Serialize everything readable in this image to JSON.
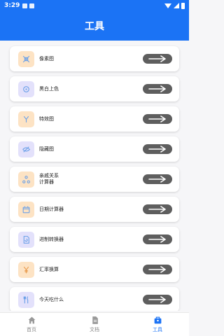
{
  "status": {
    "time": "3:29"
  },
  "appbar": {
    "title": "工具"
  },
  "tools": [
    {
      "label": "像素图",
      "icon": "pixel-grid-icon",
      "tint": "orange"
    },
    {
      "label": "黑白上色",
      "icon": "colorize-icon",
      "tint": "purple"
    },
    {
      "label": "特效图",
      "icon": "effect-icon",
      "tint": "orange"
    },
    {
      "label": "隐藏图",
      "icon": "hidden-image-icon",
      "tint": "purple"
    },
    {
      "label": "亲戚关系\n计算器",
      "icon": "family-tree-icon",
      "tint": "orange"
    },
    {
      "label": "日期计算器",
      "icon": "calendar-icon",
      "tint": "orange"
    },
    {
      "label": "进制转换器",
      "icon": "base-convert-icon",
      "tint": "purple"
    },
    {
      "label": "汇率换算",
      "icon": "yen-icon",
      "tint": "orange"
    },
    {
      "label": "今天吃什么",
      "icon": "food-icon",
      "tint": "purple"
    }
  ],
  "nav": {
    "home": "首页",
    "docs": "文档",
    "tools": "工具",
    "active": "tools"
  },
  "colors": {
    "brand": "#1b73f5",
    "button": "#5e5e5e"
  }
}
